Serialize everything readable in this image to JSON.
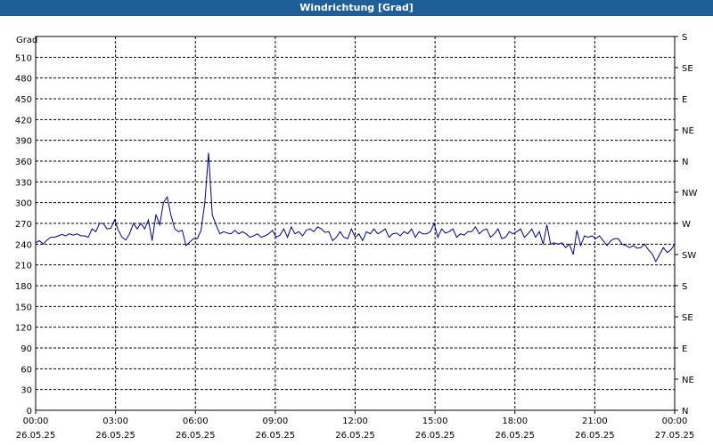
{
  "window": {
    "title": "Windrichtung [Grad]"
  },
  "colors": {
    "titlebar": "#1f5f98",
    "line": "#00008b",
    "grid": "#000000"
  },
  "chart_data": {
    "type": "line",
    "title": "Windrichtung [Grad]",
    "ylabel": "Grad",
    "ylim": [
      0,
      540
    ],
    "yticks": [
      0,
      30,
      60,
      90,
      120,
      150,
      180,
      210,
      240,
      270,
      300,
      330,
      360,
      390,
      420,
      450,
      480,
      510
    ],
    "right_axis_labels": [
      "N",
      "NE",
      "E",
      "SE",
      "S",
      "SW",
      "W",
      "NW",
      "N",
      "NE",
      "E",
      "SE",
      "S"
    ],
    "xlim": [
      "26.05.25 00:00",
      "27.05.25 00:00"
    ],
    "xticks": [
      {
        "time": "00:00",
        "date": "26.05.25"
      },
      {
        "time": "03:00",
        "date": "26.05.25"
      },
      {
        "time": "06:00",
        "date": "26.05.25"
      },
      {
        "time": "09:00",
        "date": "26.05.25"
      },
      {
        "time": "12:00",
        "date": "26.05.25"
      },
      {
        "time": "15:00",
        "date": "26.05.25"
      },
      {
        "time": "18:00",
        "date": "26.05.25"
      },
      {
        "time": "21:00",
        "date": "26.05.25"
      },
      {
        "time": "00:00",
        "date": "27.05.25"
      }
    ],
    "grid": true,
    "x_hours": [
      0,
      0.2,
      0.4,
      0.6,
      0.8,
      1,
      1.2,
      1.4,
      1.6,
      1.8,
      2,
      2.2,
      2.4,
      2.6,
      2.8,
      3,
      3.2,
      3.4,
      3.6,
      3.8,
      4,
      4.2,
      4.4,
      4.6,
      4.8,
      5,
      5.2,
      5.4,
      5.6,
      5.8,
      6,
      6.2,
      6.4,
      6.6,
      6.8,
      7,
      7.2,
      7.4,
      7.6,
      7.8,
      8,
      8.2,
      8.4,
      8.6,
      8.8,
      9,
      9.2,
      9.4,
      9.6,
      9.8,
      10,
      10.2,
      10.4,
      10.6,
      10.8,
      11,
      11.2,
      11.4,
      11.6,
      11.8,
      12,
      12.2,
      12.4,
      12.6,
      12.8,
      13,
      13.2,
      13.4,
      13.6,
      13.8,
      14,
      14.2,
      14.4,
      14.6,
      14.8,
      15,
      15.2,
      15.4,
      15.6,
      15.8,
      16,
      16.2,
      16.4,
      16.6,
      16.8,
      17,
      17.2,
      17.4,
      17.6,
      17.8,
      18,
      18.2,
      18.4,
      18.6,
      18.8,
      19,
      19.2,
      19.4,
      19.6,
      19.8,
      20,
      20.2,
      20.4,
      20.6,
      20.8,
      21,
      21.2,
      21.4,
      21.6,
      21.8,
      22,
      22.2,
      22.4,
      22.6,
      22.8,
      23,
      23.2,
      23.4,
      23.6,
      23.8,
      24
    ],
    "series": [
      {
        "values": [
          242,
          245,
          240,
          246,
          250,
          250,
          252,
          254,
          252,
          255,
          253,
          255,
          252,
          252,
          250,
          262,
          258,
          270,
          270,
          262,
          263,
          275,
          260,
          250,
          246,
          255,
          270,
          262,
          270,
          262,
          275,
          245,
          283,
          268,
          300,
          308,
          282,
          262,
          258,
          260,
          238,
          243,
          248,
          248,
          260,
          300,
          372,
          282,
          268,
          255,
          258,
          256,
          255,
          260,
          255,
          258,
          255,
          250,
          252,
          255,
          250,
          252,
          255,
          260,
          250,
          253,
          262,
          250,
          265,
          255,
          258,
          252,
          260,
          262,
          258,
          265,
          262,
          257,
          258,
          245,
          250,
          258,
          250,
          248,
          262,
          250,
          255,
          245,
          258,
          255,
          262,
          255,
          258,
          262,
          250,
          255,
          256,
          252,
          258,
          255,
          262,
          250,
          258,
          255,
          255,
          258,
          270,
          250,
          262,
          256,
          258,
          262,
          250,
          255,
          253,
          258,
          258,
          265,
          255,
          260,
          262,
          250,
          255,
          262,
          248,
          250,
          258,
          255,
          258,
          262,
          250,
          255,
          262,
          250,
          258,
          240,
          268,
          240,
          242,
          240,
          242,
          235,
          240,
          225,
          260,
          238,
          252,
          250,
          252,
          248,
          252,
          245,
          238,
          245,
          248,
          248,
          240,
          238,
          235,
          238,
          234,
          235,
          240,
          232,
          226,
          215,
          225,
          235,
          228,
          232,
          240
        ],
        "name": ""
      }
    ]
  }
}
